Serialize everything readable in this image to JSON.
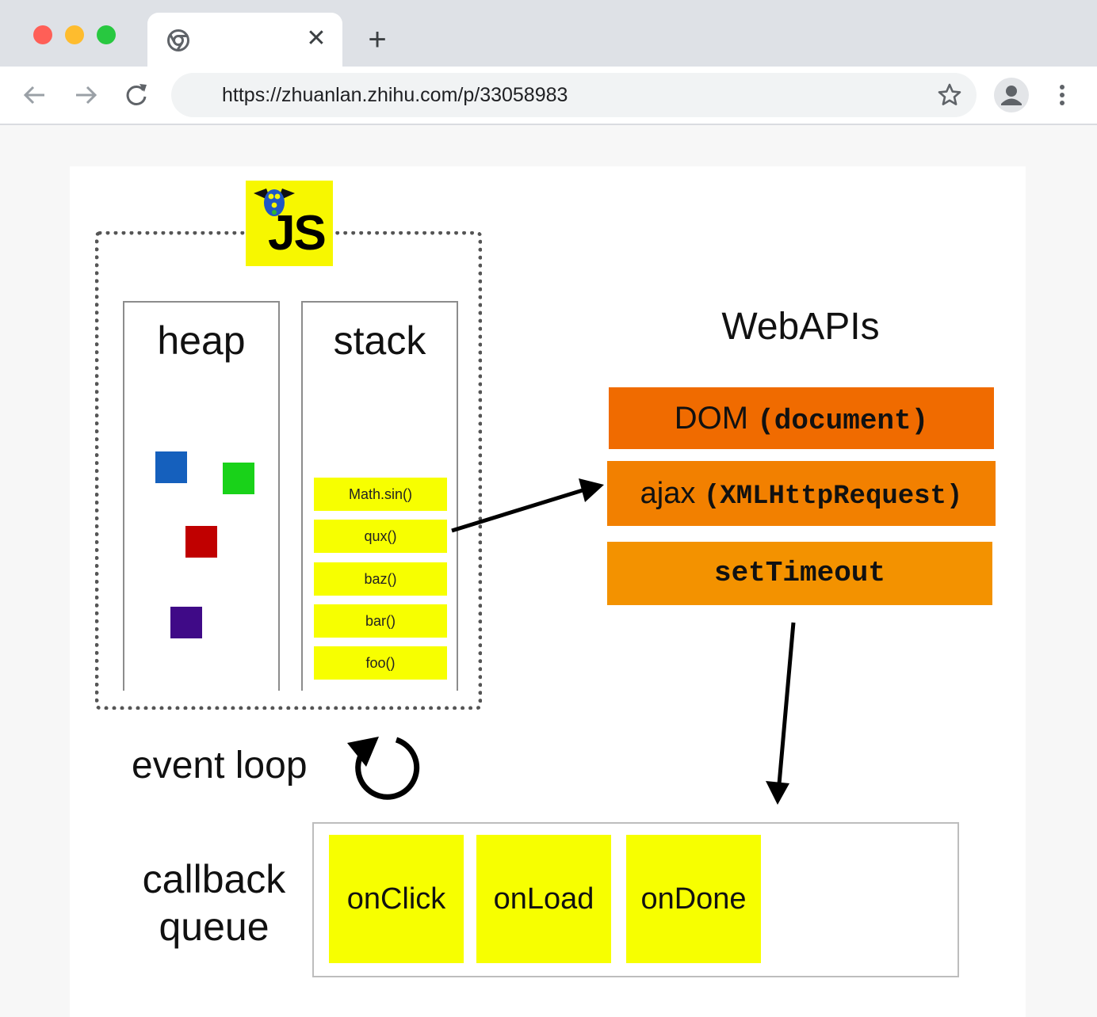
{
  "browser": {
    "tab_close_glyph": "✕",
    "new_tab_glyph": "+",
    "url": "https://zhuanlan.zhihu.com/p/33058983",
    "icons": [
      "chrome-favicon-icon",
      "back-arrow-icon",
      "forward-arrow-icon",
      "reload-icon",
      "bookmark-star-icon",
      "profile-icon",
      "more-menu-icon"
    ],
    "traffic_colors": [
      "#ff5f57",
      "#febc2e",
      "#28c840"
    ]
  },
  "diagram": {
    "js_logo_text": "JS",
    "heap": {
      "title": "heap",
      "object_colors": [
        "#1560bd",
        "#19d219",
        "#c00000",
        "#3f0a87"
      ]
    },
    "stack": {
      "title": "stack",
      "frames": [
        "Math.sin()",
        "qux()",
        "baz()",
        "bar()",
        "foo()"
      ]
    },
    "webapis": {
      "title": "WebAPIs",
      "dom": {
        "label": "DOM",
        "mono": "(document)",
        "color": "#f06b00"
      },
      "ajax": {
        "label": "ajax",
        "mono": "(XMLHttpRequest)",
        "color": "#f28000"
      },
      "settimeout": {
        "mono": "setTimeout",
        "color": "#f39200"
      }
    },
    "event_loop": {
      "label": "event loop"
    },
    "callback_queue": {
      "label_line1": "callback",
      "label_line2": "queue",
      "items": [
        "onClick",
        "onLoad",
        "onDone"
      ]
    },
    "accent_yellow": "#f7ff00"
  }
}
